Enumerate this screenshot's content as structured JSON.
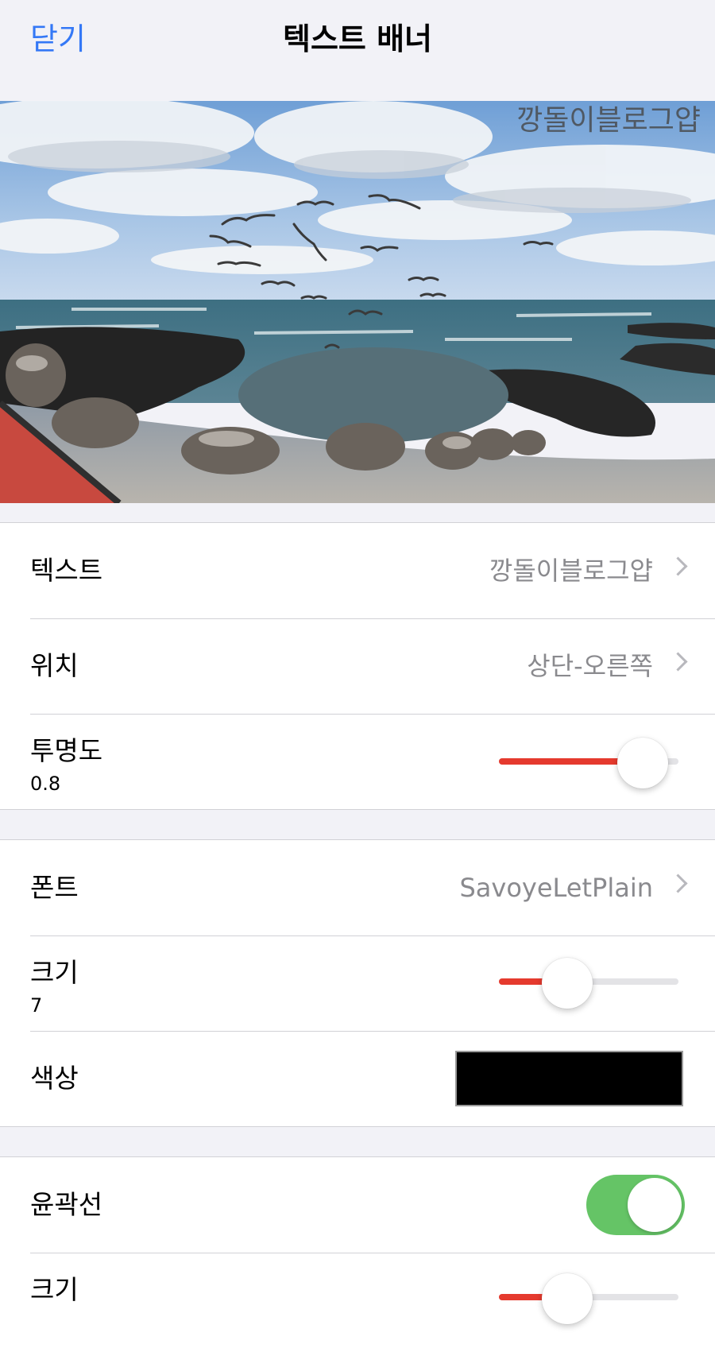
{
  "header": {
    "close_label": "닫기",
    "title": "텍스트 배너"
  },
  "preview": {
    "banner_text": "깡돌이블로그얍",
    "image_icon": "seaside-photo"
  },
  "banner_group": {
    "text_row": {
      "label": "텍스트",
      "value": "깡돌이블로그얍"
    },
    "position_row": {
      "label": "위치",
      "value": "상단-오른쪽"
    },
    "opacity_row": {
      "label": "투명도",
      "value_text": "0.8",
      "slider_value": 0.8
    }
  },
  "font_group": {
    "font_row": {
      "label": "폰트",
      "value": "SavoyeLetPlain"
    },
    "size_row": {
      "label": "크기",
      "value_text": "7",
      "slider_fraction": 0.38
    },
    "color_row": {
      "label": "색상",
      "color": "#000000"
    }
  },
  "outline_group": {
    "outline_row": {
      "label": "윤곽선",
      "enabled": true
    },
    "size_row": {
      "label": "크기",
      "slider_fraction": 0.38
    }
  },
  "colors": {
    "accent": "#3478f6",
    "slider_fill": "#e53a2e",
    "toggle_on": "#65c466"
  }
}
